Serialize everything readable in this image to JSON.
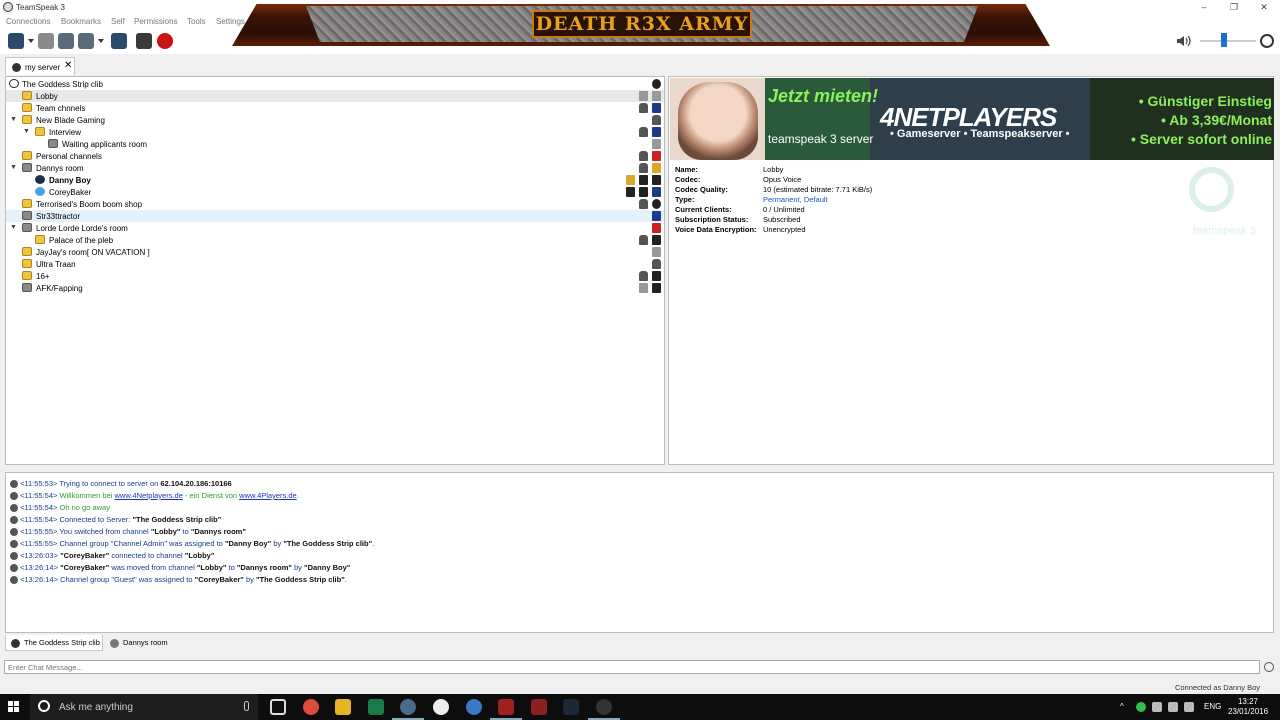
{
  "window": {
    "title": "TeamSpeak 3",
    "controls": [
      "minimize",
      "restore",
      "close"
    ]
  },
  "menubar": [
    "Connections",
    "Bookmarks",
    "Self",
    "Permissions",
    "Tools",
    "Settings"
  ],
  "banner": {
    "logo_text": "DEATH R3X ARMY"
  },
  "server_tab": {
    "label": "my server",
    "close": "✕"
  },
  "tree": {
    "server": "The Goddess Strip clib",
    "rows": [
      {
        "label": "Lobby"
      },
      {
        "label": "Team chnnels"
      },
      {
        "label": "New Blade Gaming"
      },
      {
        "label": "Interview"
      },
      {
        "label": "Waiting applicants room"
      },
      {
        "label": "Personal channels"
      },
      {
        "label": "Dannys room"
      },
      {
        "label": "Danny Boy"
      },
      {
        "label": "CoreyBaker"
      },
      {
        "label": "Terrorised's Boom boom shop"
      },
      {
        "label": "Str33ttractor"
      },
      {
        "label": "Lorde Lorde Lorde's room"
      },
      {
        "label": "Palace of the pleb"
      },
      {
        "label": "JayJay's room[ ON VACATION ]"
      },
      {
        "label": "Ultra Traan"
      },
      {
        "label": "16+"
      },
      {
        "label": "AFK/Fapping"
      }
    ]
  },
  "ad": {
    "headline": "Jetzt mieten!",
    "product": "teamspeak 3 server",
    "brand": "4NETPLAYERS",
    "brand_sub": "• Gameserver • Teamspeakserver •",
    "bullets": [
      "• Günstiger Einstieg",
      "• Ab 3,39€/Monat",
      "• Server sofort online"
    ]
  },
  "info": {
    "name_label": "Name:",
    "name": "Lobby",
    "codec_label": "Codec:",
    "codec": "Opus Voice",
    "quality_label": "Codec Quality:",
    "quality": "10 (estimated bitrate: 7.71 KiB/s)",
    "type_label": "Type:",
    "type": "Permanent, Default",
    "clients_label": "Current Clients:",
    "clients": "0 / Unlimited",
    "subscription_label": "Subscription Status:",
    "subscription": "Subscribed",
    "encryption_label": "Voice Data Encryption:",
    "encryption": "Unencrypted",
    "watermark": "teamspeak 3"
  },
  "log": [
    {
      "ts": "<11:55:53>",
      "msg": "Trying to connect to server on ",
      "bold": "62.104.20.186:10166",
      "tail": ""
    },
    {
      "ts": "<11:55:54>",
      "msg": "Willkommen bei ",
      "link1": "www.4Netplayers.de",
      "mid": " - ein Dienst von ",
      "link2": "www.4Players.de",
      "tail": "."
    },
    {
      "ts": "<11:55:54>",
      "msg": "Oh no go away"
    },
    {
      "ts": "<11:55:54>",
      "msg": "Connected to Server: ",
      "bold": "\"The Goddess Strip clib\"",
      "tail": ""
    },
    {
      "ts": "<11:55:55>",
      "msg": "You switched from channel ",
      "bold": "\"Lobby\"",
      "mid": " to ",
      "bold2": "\"Dannys room\""
    },
    {
      "ts": "<11:55:55>",
      "msg": "Channel group \"Channel Admin\" was assigned to ",
      "bold": "\"Danny Boy\"",
      "mid": " by ",
      "bold2": "\"The Goddess Strip clib\"",
      "tail": "."
    },
    {
      "ts": "<13:26:03>",
      "msg": "",
      "bold": "\"CoreyBaker\"",
      "mid": " connected to channel ",
      "bold2": "\"Lobby\""
    },
    {
      "ts": "<13:26:14>",
      "msg": "",
      "bold": "\"CoreyBaker\"",
      "mid": " was moved from channel ",
      "bold2": "\"Lobby\"",
      "mid2": " to ",
      "bold3": "\"Dannys room\"",
      "mid3": " by ",
      "bold4": "\"Danny Boy\""
    },
    {
      "ts": "<13:26:14>",
      "msg": "Channel group \"Guest\" was assigned to ",
      "bold": "\"CoreyBaker\"",
      "mid": " by ",
      "bold2": "\"The Goddess Strip clib\"",
      "tail": "."
    }
  ],
  "bottom_tabs": [
    "The Goddess Strip clib",
    "Dannys room"
  ],
  "chat": {
    "placeholder": "Enter Chat Message..."
  },
  "status": "Connected as Danny Boy",
  "taskbar": {
    "search_placeholder": "Ask me anything",
    "lang": "ENG",
    "time": "13:27",
    "date": "23/01/2016"
  }
}
